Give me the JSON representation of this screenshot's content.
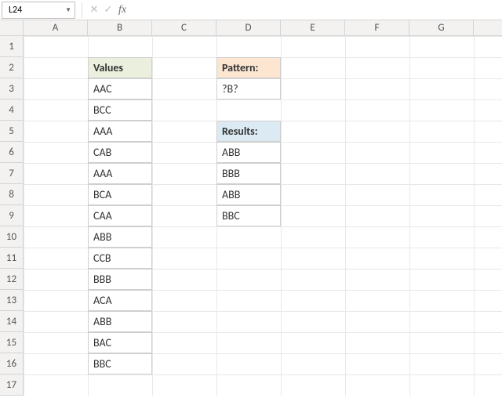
{
  "formula_bar": {
    "name_box": "L24",
    "formula": ""
  },
  "columns": [
    "A",
    "B",
    "C",
    "D",
    "E",
    "F",
    "G"
  ],
  "rows": [
    "1",
    "2",
    "3",
    "4",
    "5",
    "6",
    "7",
    "8",
    "9",
    "10",
    "11",
    "12",
    "13",
    "14",
    "15",
    "16",
    "17"
  ],
  "chart_data": {
    "type": "table",
    "values_header": "Values",
    "values": [
      "AAC",
      "BCC",
      "AAA",
      "CAB",
      "AAA",
      "BCA",
      "CAA",
      "ABB",
      "CCB",
      "BBB",
      "ACA",
      "ABB",
      "BAC",
      "BBC"
    ],
    "pattern_header": "Pattern:",
    "pattern": "?B?",
    "results_header": "Results:",
    "results": [
      "ABB",
      "BBB",
      "ABB",
      "BBC"
    ]
  }
}
